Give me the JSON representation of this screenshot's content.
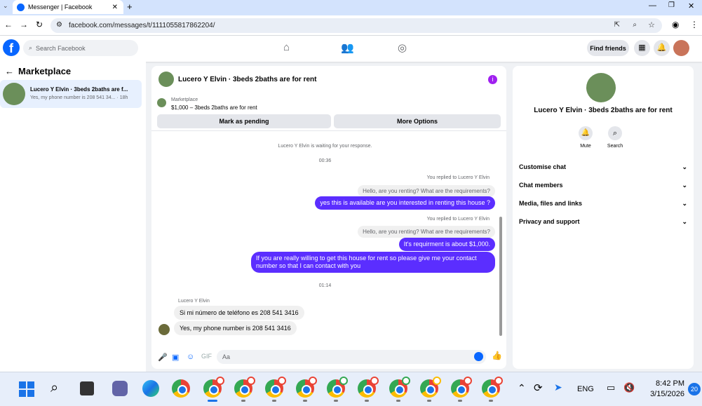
{
  "browser": {
    "tab_title": "Messenger | Facebook",
    "url": "facebook.com/messages/t/1111055817862204/"
  },
  "fb": {
    "search_placeholder": "Search Facebook",
    "find_friends": "Find friends"
  },
  "left": {
    "title": "Marketplace",
    "conversation": {
      "name": "Lucero Y Elvin · 3beds 2baths are f...",
      "preview": "Yes, my phone number is 208 541 34... · 18h"
    }
  },
  "chat": {
    "header_name": "Lucero Y Elvin · 3beds 2baths are for rent",
    "listing_label": "Marketplace",
    "listing_price": "$1,000 – 3beds 2baths are for rent",
    "mark_pending": "Mark as pending",
    "more_options": "More Options",
    "waiting_note": "Lucero Y Elvin is waiting for your response.",
    "time1": "00:36",
    "reply_note1": "You replied to Lucero Y Elvin",
    "quote1": "Hello, are you renting? What are the requirements?",
    "msg1": "yes this is available are you interested in renting this house ?",
    "reply_note2": "You replied to Lucero Y Elvin",
    "quote2": "Hello, are you renting? What are the requirements?",
    "msg2": "It's requirment is about $1,000.",
    "msg3": "If you are really willing to get this house for rent so please give me your contact number so that I  can contact with you",
    "time2": "01:14",
    "sender": "Lucero Y Elvin",
    "in1": "Si mi número de teléfono es 208 541 3416",
    "in2": "Yes, my phone number is 208 541 3416",
    "composer_placeholder": "Aa"
  },
  "right": {
    "name": "Lucero Y Elvin · 3beds 2baths are for rent",
    "mute": "Mute",
    "search": "Search",
    "rows": [
      "Customise chat",
      "Chat members",
      "Media, files and links",
      "Privacy and support"
    ]
  },
  "taskbar": {
    "lang": "ENG",
    "time": "8:42 PM",
    "date": "3/15/2026",
    "notif_count": "20"
  },
  "colors": {
    "accent": "#5b2eff",
    "fb_blue": "#0866ff"
  }
}
